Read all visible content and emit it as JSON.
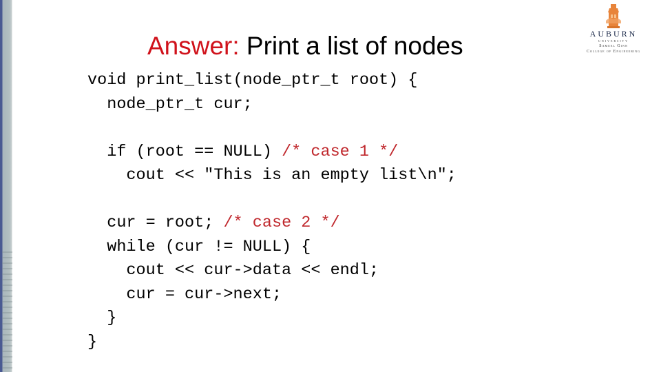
{
  "slide": {
    "title_accent": "Answer:",
    "title_rest": " Print a list of nodes",
    "accent_color": "#d0121b",
    "comment_color": "#c0282d"
  },
  "logo": {
    "name": "AUBURN",
    "university": "UNIVERSITY",
    "line1": "Samuel Ginn",
    "line2": "College of Engineering"
  },
  "code": {
    "lines": [
      {
        "indent": "",
        "code": "void print_list(node_ptr_t root) {",
        "comment": ""
      },
      {
        "indent": "  ",
        "code": "node_ptr_t cur;",
        "comment": ""
      },
      {
        "indent": "",
        "code": "",
        "comment": ""
      },
      {
        "indent": "  ",
        "code": "if (root == NULL) ",
        "comment": "/* case 1 */"
      },
      {
        "indent": "    ",
        "code": "cout << \"This is an empty list\\n\";",
        "comment": ""
      },
      {
        "indent": "",
        "code": "",
        "comment": ""
      },
      {
        "indent": "  ",
        "code": "cur = root; ",
        "comment": "/* case 2 */"
      },
      {
        "indent": "  ",
        "code": "while (cur != NULL) {",
        "comment": ""
      },
      {
        "indent": "    ",
        "code": "cout << cur->data << endl;",
        "comment": ""
      },
      {
        "indent": "    ",
        "code": "cur = cur->next;",
        "comment": ""
      },
      {
        "indent": "  ",
        "code": "}",
        "comment": ""
      },
      {
        "indent": "",
        "code": "}",
        "comment": ""
      }
    ]
  }
}
